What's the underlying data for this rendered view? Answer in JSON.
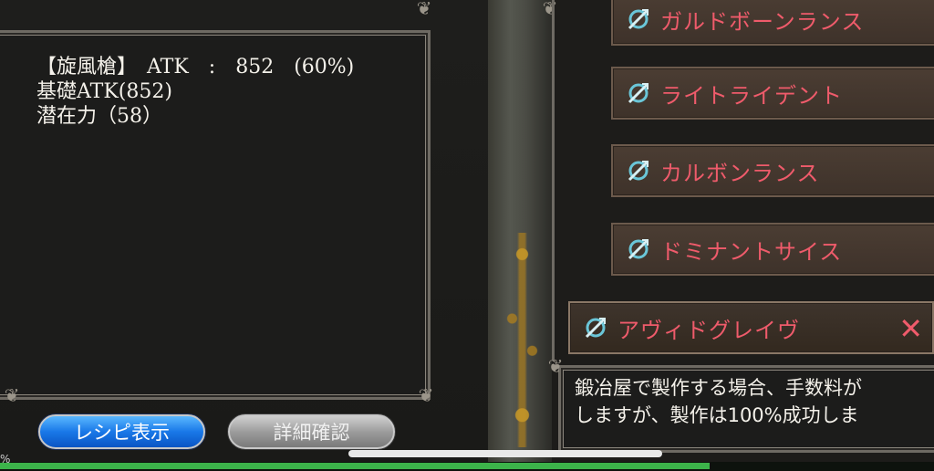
{
  "info": {
    "line1": "【旋風槍】　ATK　:　852　(60%)",
    "line2": "基礎ATK(852)",
    "line3": "潜在力（58）"
  },
  "weapon_list": [
    {
      "label": "ガルドボーンランス"
    },
    {
      "label": "ライトライデント"
    },
    {
      "label": "カルボンランス"
    },
    {
      "label": "ドミナントサイス"
    }
  ],
  "selected_item": {
    "label": "アヴィドグレイヴ",
    "close_glyph": "✕"
  },
  "description": {
    "line1": "鍛冶屋で製作する場合、手数料が",
    "line2": "しますが、製作は100%成功しま"
  },
  "buttons": {
    "recipe_label": "レシピ表示",
    "detail_label": "詳細確認"
  },
  "status": {
    "progress_fraction": 0.76,
    "progress_mark": "%"
  },
  "colors": {
    "accent_text": "#ef5b6b",
    "recipe_button": "#1978e8",
    "progress": "#3cb34a"
  },
  "icons": {
    "weapon": "weapon-icon",
    "close": "close-icon"
  }
}
